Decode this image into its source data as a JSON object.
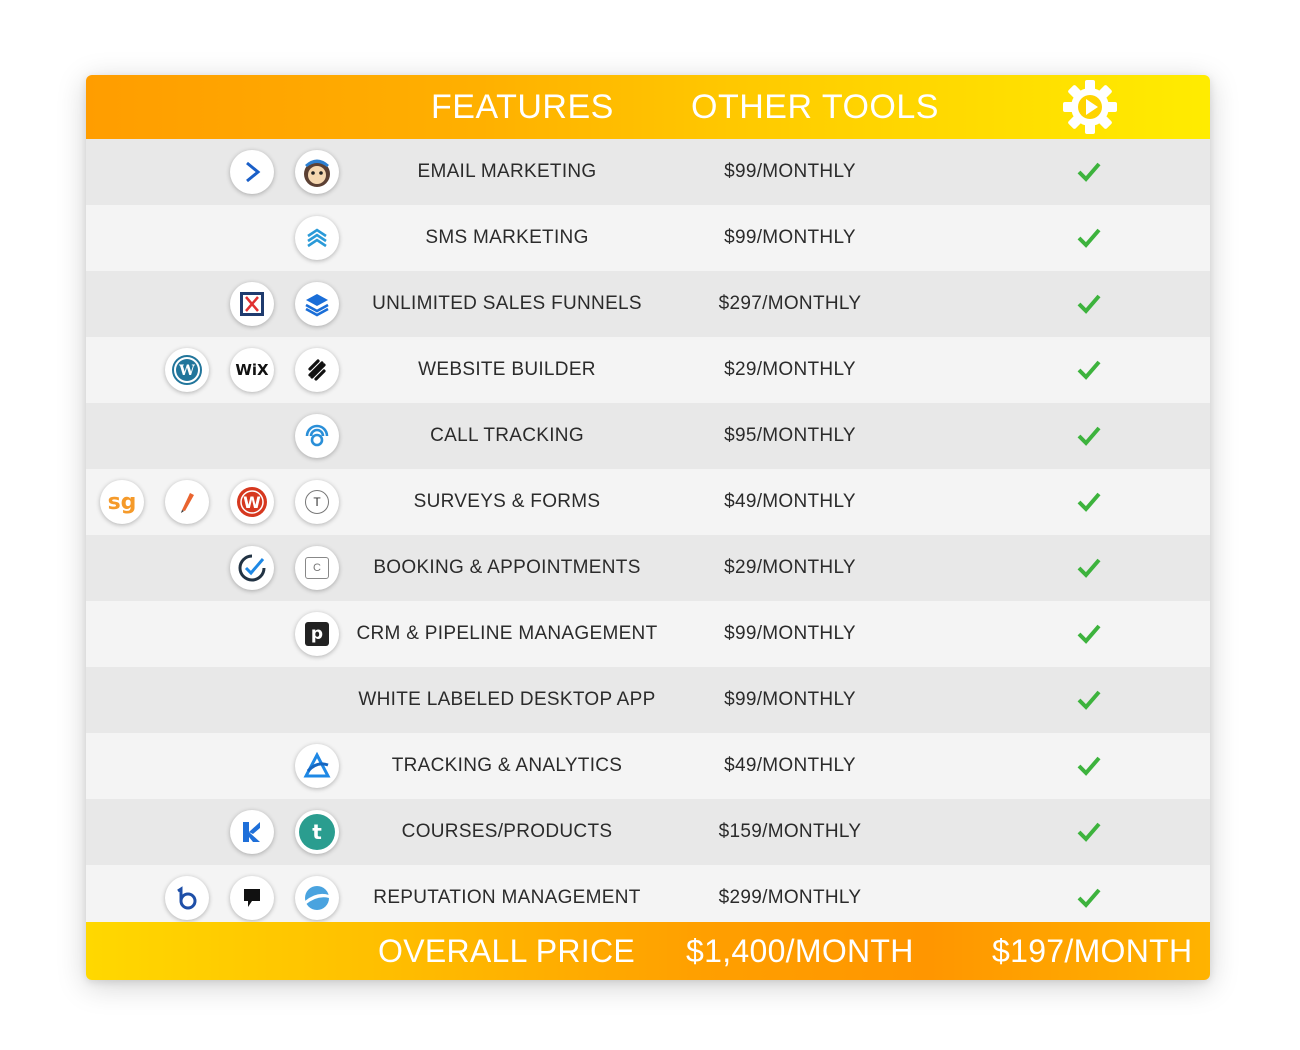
{
  "header": {
    "features_label": "FEATURES",
    "other_tools_label": "OTHER TOOLS"
  },
  "rows": [
    {
      "feature": "EMAIL MARKETING",
      "price": "$99/MONTHLY",
      "included": true
    },
    {
      "feature": "SMS MARKETING",
      "price": "$99/MONTHLY",
      "included": true
    },
    {
      "feature": "UNLIMITED SALES FUNNELS",
      "price": "$297/MONTHLY",
      "included": true
    },
    {
      "feature": "WEBSITE BUILDER",
      "price": "$29/MONTHLY",
      "included": true
    },
    {
      "feature": "CALL TRACKING",
      "price": "$95/MONTHLY",
      "included": true
    },
    {
      "feature": "SURVEYS & FORMS",
      "price": "$49/MONTHLY",
      "included": true
    },
    {
      "feature": "BOOKING & APPOINTMENTS",
      "price": "$29/MONTHLY",
      "included": true
    },
    {
      "feature": "CRM & PIPELINE MANAGEMENT",
      "price": "$99/MONTHLY",
      "included": true
    },
    {
      "feature": "WHITE LABELED DESKTOP APP",
      "price": "$99/MONTHLY",
      "included": true
    },
    {
      "feature": "TRACKING & ANALYTICS",
      "price": "$49/MONTHLY",
      "included": true
    },
    {
      "feature": "COURSES/PRODUCTS",
      "price": "$159/MONTHLY",
      "included": true
    },
    {
      "feature": "REPUTATION MANAGEMENT",
      "price": "$299/MONTHLY",
      "included": true
    }
  ],
  "icons": {
    "wix_text": "WiX",
    "surveygizmo_text": "sg",
    "typeform_text": "T",
    "calendly_text": "C",
    "pipedrive_text": "p",
    "teachable_text": "t"
  },
  "footer": {
    "overall_label": "OVERALL PRICE",
    "other_total": "$1,400/MONTH",
    "our_total": "$197/MONTH"
  },
  "colors": {
    "header_start": "#ff9d00",
    "header_end": "#ffec00",
    "check_green": "#3db33d",
    "row_odd": "#e8e8e8",
    "row_even": "#f4f4f4"
  }
}
